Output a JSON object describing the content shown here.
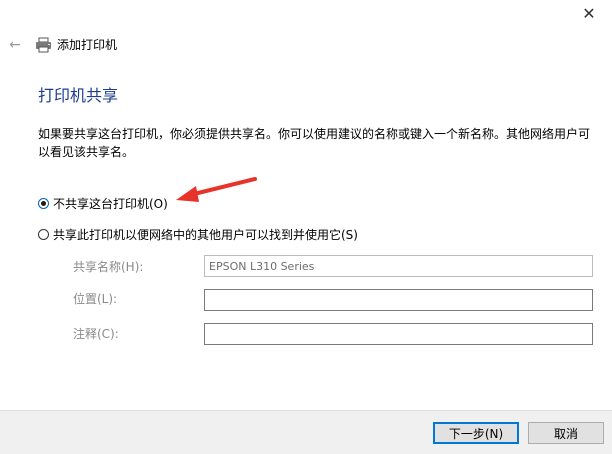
{
  "window": {
    "title": "添加打印机",
    "close_glyph": "✕",
    "back_glyph": "←"
  },
  "page": {
    "heading": "打印机共享",
    "instructions": "如果要共享这台打印机，你必须提供共享名。你可以使用建议的名称或键入一个新名称。其他网络用户可以看见该共享名。"
  },
  "options": [
    {
      "label": "不共享这台打印机(O)",
      "checked": true
    },
    {
      "label": "共享此打印机以便网络中的其他用户可以找到并使用它(S)",
      "checked": false
    }
  ],
  "fields": {
    "share_name": {
      "label": "共享名称(H):",
      "value": "EPSON L310 Series"
    },
    "location": {
      "label": "位置(L):",
      "value": ""
    },
    "comment": {
      "label": "注释(C):",
      "value": ""
    }
  },
  "buttons": {
    "next": "下一步(N)",
    "cancel": "取消"
  },
  "colors": {
    "heading": "#1e3d8f",
    "annotation_arrow": "#e8332a",
    "primary_border": "#0078d7"
  }
}
